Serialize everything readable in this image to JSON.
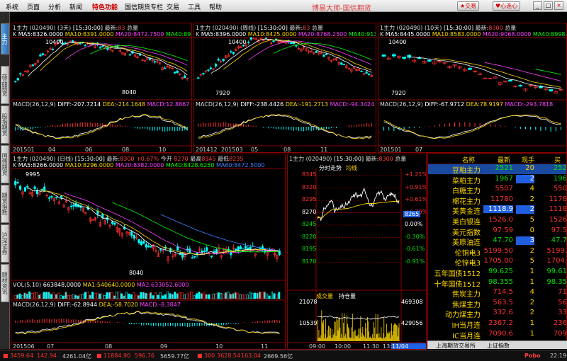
{
  "menu": [
    "系统",
    "页面",
    "分析",
    "新闻",
    "特色功能",
    "国信期货专栏",
    "交易",
    "工具",
    "帮助"
  ],
  "app_title": "博易大师-国信期货",
  "buttons": {
    "trade": "交易",
    "logout": "心连心",
    "min": "_",
    "max": "□",
    "close": "×"
  },
  "left_tabs": [
    "主力",
    "商品期货",
    "股指期货",
    "国债期货",
    "期货指数",
    "沪深证券",
    "题材资讯"
  ],
  "panels": {
    "p1": {
      "title": "1主力 (020490) (3天)",
      "time": "[15:30:00]",
      "lp_label": "最新:",
      "lp": "83",
      "extra": "总量",
      "ma": {
        "k": "K",
        "ma5": "MA5:8326.0000",
        "ma10": "MA10:8391.0000",
        "ma20": "MA20:8472.7500",
        "ma40": "MA40:8945.3750"
      },
      "high": "10400",
      "low": "8040",
      "macd": {
        "label": "MACD(26,12,9)",
        "diff": "DIFF:-207.7214",
        "dea": "DEA:-214.1648",
        "macd": "MACD:12.8867"
      },
      "xlabels": [
        "201501",
        "04",
        "06",
        "08",
        "10"
      ]
    },
    "p2": {
      "title": "1主力 (020490) (周线)",
      "time": "[15:30:00]",
      "lp_label": "最新:",
      "lp": "83",
      "extra": "总量",
      "ma": {
        "k": "K",
        "ma5": "MA5:8396.0000",
        "ma10": "MA10:8425.0000",
        "ma20": "MA20:8768.2500",
        "ma40": "MA40:9134.1250"
      },
      "high": "10400",
      "low": "7920",
      "macd": {
        "label": "MACD(26,12,9)",
        "diff": "DIFF:-238.4426",
        "dea": "DEA:-191.2713",
        "macd": "MACD:-94.3424"
      },
      "xlabels": [
        "201412",
        "201503",
        "05",
        "08",
        "11"
      ]
    },
    "p3": {
      "title": "1主力 (020490) (10天)",
      "time": "[15:30:00]",
      "lp_label": "最新:",
      "lp": "8300",
      "extra": "总量",
      "ma": {
        "k": "K",
        "ma5": "MA5:8445.0000",
        "ma10": "MA10:8583.0000",
        "ma20": "MA20:9068.0000",
        "ma40": "MA40:8998.6364"
      },
      "high": "10400",
      "low": "7920",
      "macd": {
        "label": "MACD(26,12,9)",
        "diff": "DIFF:-67.9712",
        "dea": "DEA:78.9197",
        "macd": "MACD:-293.7818"
      },
      "xlabels": [
        "201501",
        "07"
      ]
    },
    "p4": {
      "title": "1主力 (020490) (日线)",
      "time": "[15:30:00]",
      "lp_label": "最新:",
      "lp": "8300",
      "chg": "+0.67%",
      "open_label": "今开",
      "open": "8270",
      "high_label": "最高",
      "high_v": "8345",
      "low_label": "最低",
      "low_v": "8235",
      "ma": {
        "k": "K",
        "ma5": "MA5:8266.0000",
        "ma10": "MA10:8296.0000",
        "ma20": "MA20:8382.0000",
        "ma40": "MA40:8428.6250",
        "ma60": "MA60:8472.5000"
      },
      "high": "9995",
      "low": "8040",
      "vol": {
        "label": "VOL(5,10)",
        "v": "663848.0000",
        "ma1": "MA1:540640.0000",
        "ma2": "MA2:633052.6000"
      },
      "macd": {
        "label": "MACD(26,12,9)",
        "diff": "DIFF:-62.8944",
        "dea": "DEA:-58.7020",
        "macd": "MACD:-8.3847"
      },
      "xlabels": [
        "201506",
        "07",
        "08",
        "09",
        "10",
        "11"
      ]
    },
    "p5": {
      "title": "1主力 (020490)",
      "time": "[15:30:00]",
      "lp_label": "最新:",
      "lp": "8300",
      "extra": "总量",
      "sub1": "分时走势",
      "sub2": "均线",
      "prices": [
        "8345",
        "8320",
        "8295",
        "8270",
        "8245",
        "8220",
        "8195",
        "8170"
      ],
      "pcts": [
        "+1.21%",
        "+0.91%",
        "+0.61%",
        "+0.30%",
        "0.00%",
        "-0.30%",
        "-0.61%",
        "-0.91%"
      ],
      "cur": "8265",
      "vol_title": "成交量",
      "oi_title": "持仓量",
      "vol_l": [
        "21078",
        "10539"
      ],
      "oi_r": [
        "469308",
        "429056"
      ],
      "xlabels": [
        "09:00",
        "10:00",
        "11:30",
        "13:30"
      ],
      "date": "11/04 14:28"
    }
  },
  "quote": {
    "headers": [
      "名称",
      "最新",
      "现手",
      "买"
    ],
    "rows": [
      {
        "name": "豆粕主力",
        "price": "2521",
        "vol": "20",
        "bid": "252",
        "sel": true,
        "dir": "dn"
      },
      {
        "name": "菜粕主力",
        "price": "1967",
        "vol": "2",
        "bid": "196",
        "sel": false,
        "dir": "dn",
        "hl": true
      },
      {
        "name": "白糖主力",
        "price": "5507",
        "vol": "4",
        "bid": "550",
        "sel": false,
        "dir": "up"
      },
      {
        "name": "棉花主力",
        "price": "11780",
        "vol": "2",
        "bid": "1178",
        "sel": false,
        "dir": "up"
      },
      {
        "name": "美黄金连",
        "price": "1118.9",
        "vol": "2",
        "bid": "1118",
        "sel": false,
        "dir": "up",
        "hl": true,
        "phl": true
      },
      {
        "name": "美白银连",
        "price": "1526.0",
        "vol": "5",
        "bid": "1526",
        "sel": false,
        "dir": "up"
      },
      {
        "name": "美元指数",
        "price": "97.59",
        "vol": "0",
        "bid": "97.5",
        "sel": false,
        "dir": "up"
      },
      {
        "name": "美原油连",
        "price": "47.70",
        "vol": "3",
        "bid": "47.7",
        "sel": false,
        "dir": "dn",
        "hl": true
      },
      {
        "name": "伦铜电3",
        "price": "5199.50",
        "vol": "2",
        "bid": "5199.",
        "sel": false,
        "dir": "up"
      },
      {
        "name": "伦锌电3",
        "price": "1705.00",
        "vol": "5",
        "bid": "1704.",
        "sel": false,
        "dir": "up"
      },
      {
        "name": "五年国债1512",
        "price": "99.625",
        "vol": "1",
        "bid": "99.61",
        "sel": false,
        "dir": "dn"
      },
      {
        "name": "十年国债1512",
        "price": "98.355",
        "vol": "1",
        "bid": "98.35",
        "sel": false,
        "dir": "dn"
      },
      {
        "name": "焦炭主力",
        "price": "714.5",
        "vol": "4",
        "bid": "71",
        "sel": false,
        "dir": "up"
      },
      {
        "name": "焦煤主力",
        "price": "563.5",
        "vol": "2",
        "bid": "56",
        "sel": false,
        "dir": "up"
      },
      {
        "name": "动力煤主力",
        "price": "332.6",
        "vol": "2",
        "bid": "33",
        "sel": false,
        "dir": "up"
      },
      {
        "name": "IH当月连",
        "price": "2367.2",
        "vol": "1",
        "bid": "236",
        "sel": false,
        "dir": "up"
      },
      {
        "name": "IC当月连",
        "price": "7090.6",
        "vol": "1",
        "bid": "709",
        "sel": false,
        "dir": "up"
      }
    ],
    "tabs": [
      "上海期货交易所",
      "上证指数"
    ]
  },
  "status": {
    "a": "3459.64",
    "b": "142.94",
    "c": "4261.04亿",
    "d": "11884.90",
    "e": "596.76",
    "f": "5659.77亿",
    "g": "300",
    "h": "3628.54",
    "i": "163.04",
    "j": "2669.56亿",
    "brand": "Pobo",
    "time": "22:19"
  },
  "colors": {
    "up": "#ff3030",
    "down": "#00e000",
    "accent": "#ffd700",
    "border": "#8b0000"
  }
}
